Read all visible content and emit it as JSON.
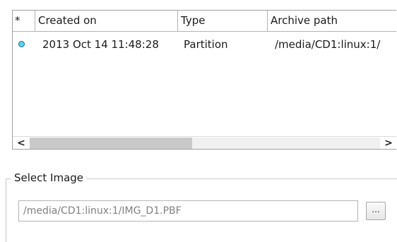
{
  "table": {
    "columns": [
      "*",
      "Created on",
      "Type",
      "Archive path"
    ],
    "rows": [
      {
        "status_icon": "circle-status-icon",
        "status_color": "#5fd3f0",
        "created_on": "2013 Oct 14 11:48:28",
        "type": "Partition",
        "archive_path": "/media/CD1:linux:1/"
      }
    ],
    "scrollbar": {
      "left_arrow": "<",
      "right_arrow": ">"
    }
  },
  "select_image": {
    "title": "Select Image",
    "path_value": "/media/CD1:linux:1/IMG_D1.PBF",
    "browse_label": "..."
  }
}
